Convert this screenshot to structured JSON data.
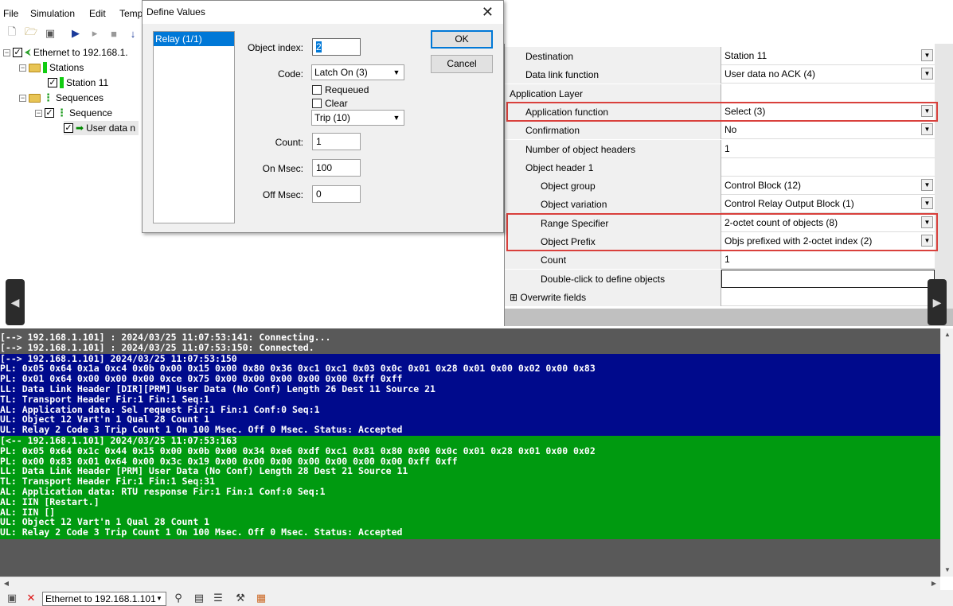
{
  "menu": [
    "File",
    "Simulation",
    "Edit",
    "Temp"
  ],
  "tree": {
    "root": "Ethernet to 192.168.1.",
    "stations": "Stations",
    "station": "Station 11",
    "sequences": "Sequences",
    "sequence": "Sequence",
    "item": "User data n"
  },
  "dialog": {
    "title": "Define Values",
    "list_item": "Relay (1/1)",
    "object_index_label": "Object index:",
    "object_index_value": "2",
    "code_label": "Code:",
    "code_value": "Latch On (3)",
    "requeued_label": "Requeued",
    "clear_label": "Clear",
    "trip_value": "Trip (10)",
    "count_label": "Count:",
    "count_value": "1",
    "on_msec_label": "On Msec:",
    "on_msec_value": "100",
    "off_msec_label": "Off Msec:",
    "off_msec_value": "0",
    "ok": "OK",
    "cancel": "Cancel"
  },
  "properties": [
    {
      "name": "Destination",
      "value": "Station 11",
      "dropdown": true,
      "indent": 1
    },
    {
      "name": "Data link function",
      "value": "User data no ACK (4)",
      "dropdown": true,
      "indent": 1
    },
    {
      "name": "Application Layer",
      "value": "",
      "dropdown": false,
      "indent": 0
    },
    {
      "name": "Application function",
      "value": "Select (3)",
      "dropdown": true,
      "indent": 1
    },
    {
      "name": "Confirmation",
      "value": "No",
      "dropdown": true,
      "indent": 1
    },
    {
      "name": "Number of object headers",
      "value": "1",
      "dropdown": false,
      "indent": 1
    },
    {
      "name": "Object header 1",
      "value": "",
      "dropdown": false,
      "indent": 1
    },
    {
      "name": "Object group",
      "value": "Control Block (12)",
      "dropdown": true,
      "indent": 2
    },
    {
      "name": "Object variation",
      "value": "Control Relay Output Block (1)",
      "dropdown": true,
      "indent": 2
    },
    {
      "name": "Range Specifier",
      "value": "2-octet count of objects (8)",
      "dropdown": true,
      "indent": 2
    },
    {
      "name": "Object Prefix",
      "value": "Objs prefixed with 2-octet index (2)",
      "dropdown": true,
      "indent": 2
    },
    {
      "name": "Count",
      "value": "1",
      "dropdown": false,
      "indent": 2
    },
    {
      "name": "Double-click to define objects",
      "value": "",
      "dropdown": false,
      "indent": 2,
      "boxed": true
    },
    {
      "name": "Overwrite fields",
      "value": "",
      "dropdown": false,
      "indent": 0,
      "expander": "⊞"
    }
  ],
  "log": {
    "gray1": [
      "[--> 192.168.1.101] : 2024/03/25 11:07:53:141: Connecting...",
      "[--> 192.168.1.101] : 2024/03/25 11:07:53:150: Connected."
    ],
    "tx": [
      "[--> 192.168.1.101] 2024/03/25 11:07:53:150",
      "PL: 0x05 0x64 0x1a 0xc4 0x0b 0x00 0x15 0x00 0x80 0x36 0xc1 0xc1 0x03 0x0c 0x01 0x28 0x01 0x00 0x02 0x00 0x83",
      "PL: 0x01 0x64 0x00 0x00 0x00 0xce 0x75 0x00 0x00 0x00 0x00 0x00 0xff 0xff",
      "LL: Data Link Header [DIR][PRM] User Data (No Conf) Length 26 Dest 11 Source 21",
      "TL: Transport Header Fir:1 Fin:1 Seq:1",
      "AL: Application data: Sel request Fir:1 Fin:1 Conf:0 Seq:1",
      "UL: Object 12 Vart'n 1 Qual 28 Count 1",
      "UL: Relay 2 Code 3 Trip Count 1 On 100 Msec. Off 0 Msec. Status: Accepted"
    ],
    "rx": [
      "[<-- 192.168.1.101] 2024/03/25 11:07:53:163",
      "PL: 0x05 0x64 0x1c 0x44 0x15 0x00 0x0b 0x00 0x34 0xe6 0xdf 0xc1 0x81 0x80 0x00 0x0c 0x01 0x28 0x01 0x00 0x02",
      "PL: 0x00 0x83 0x01 0x64 0x00 0x3c 0x19 0x00 0x00 0x00 0x00 0x00 0x00 0x00 0xff 0xff",
      "LL: Data Link Header [PRM] User Data (No Conf) Length 28 Dest 21 Source 11",
      "TL: Transport Header Fir:1 Fin:1 Seq:31",
      "AL: Application data: RTU response Fir:1 Fin:1 Conf:0 Seq:1",
      "AL: IIN [Restart.]",
      "AL: IIN []",
      "UL: Object 12 Vart'n 1 Qual 28 Count 1",
      "UL: Relay 2 Code 3 Trip Count 1 On 100 Msec. Off 0 Msec. Status: Accepted"
    ]
  },
  "statusbar": {
    "connection": "Ethernet to 192.168.1.101"
  },
  "colors": {
    "tx_bg": "#000a8c",
    "rx_bg": "#009a10",
    "log_bg": "#595959",
    "highlight": "#d9403c",
    "selection": "#0078d7"
  }
}
